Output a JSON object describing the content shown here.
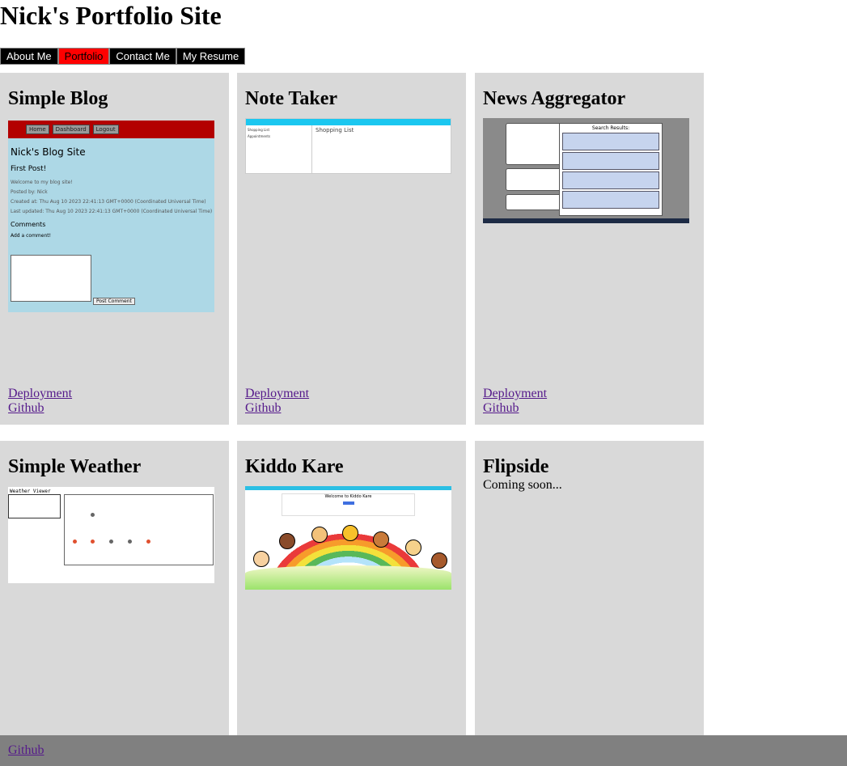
{
  "header": {
    "title": "Nick's Portfolio Site"
  },
  "nav": {
    "items": [
      {
        "label": "About Me",
        "active": false
      },
      {
        "label": "Portfolio",
        "active": true
      },
      {
        "label": "Contact Me",
        "active": false
      },
      {
        "label": "My Resume",
        "active": false
      }
    ]
  },
  "projects": [
    {
      "title": "Simple Blog",
      "deployment": "Deployment",
      "github": "Github"
    },
    {
      "title": "Note Taker",
      "deployment": "Deployment",
      "github": "Github"
    },
    {
      "title": "News Aggregator",
      "deployment": "Deployment",
      "github": "Github"
    },
    {
      "title": "Simple Weather"
    },
    {
      "title": "Kiddo Kare"
    },
    {
      "title": "Flipside",
      "note": "Coming soon..."
    }
  ],
  "screenshots": {
    "blog": {
      "nav": [
        "Home",
        "Dashboard",
        "Logout"
      ],
      "site_title": "Nick's Blog Site",
      "post_title": "First Post!",
      "body": "Welcome to my blog site!",
      "posted_by": "Posted by: Nick",
      "created": "Created at: Thu Aug 10 2023 22:41:13 GMT+0000 (Coordinated Universal Time)",
      "updated": "Last updated: Thu Aug 10 2023 22:41:13 GMT+0000 (Coordinated Universal Time)",
      "comments": "Comments",
      "add_comment": "Add a comment!",
      "post_button": "Post Comment"
    },
    "note": {
      "main_title": "Shopping List"
    },
    "news": {
      "results_title": "Search Results:"
    },
    "weather": {
      "title": "Weather Viewer"
    },
    "kiddo": {
      "welcome": "Welcome to Kiddo Kare"
    }
  },
  "footer": {
    "github": "Github"
  }
}
